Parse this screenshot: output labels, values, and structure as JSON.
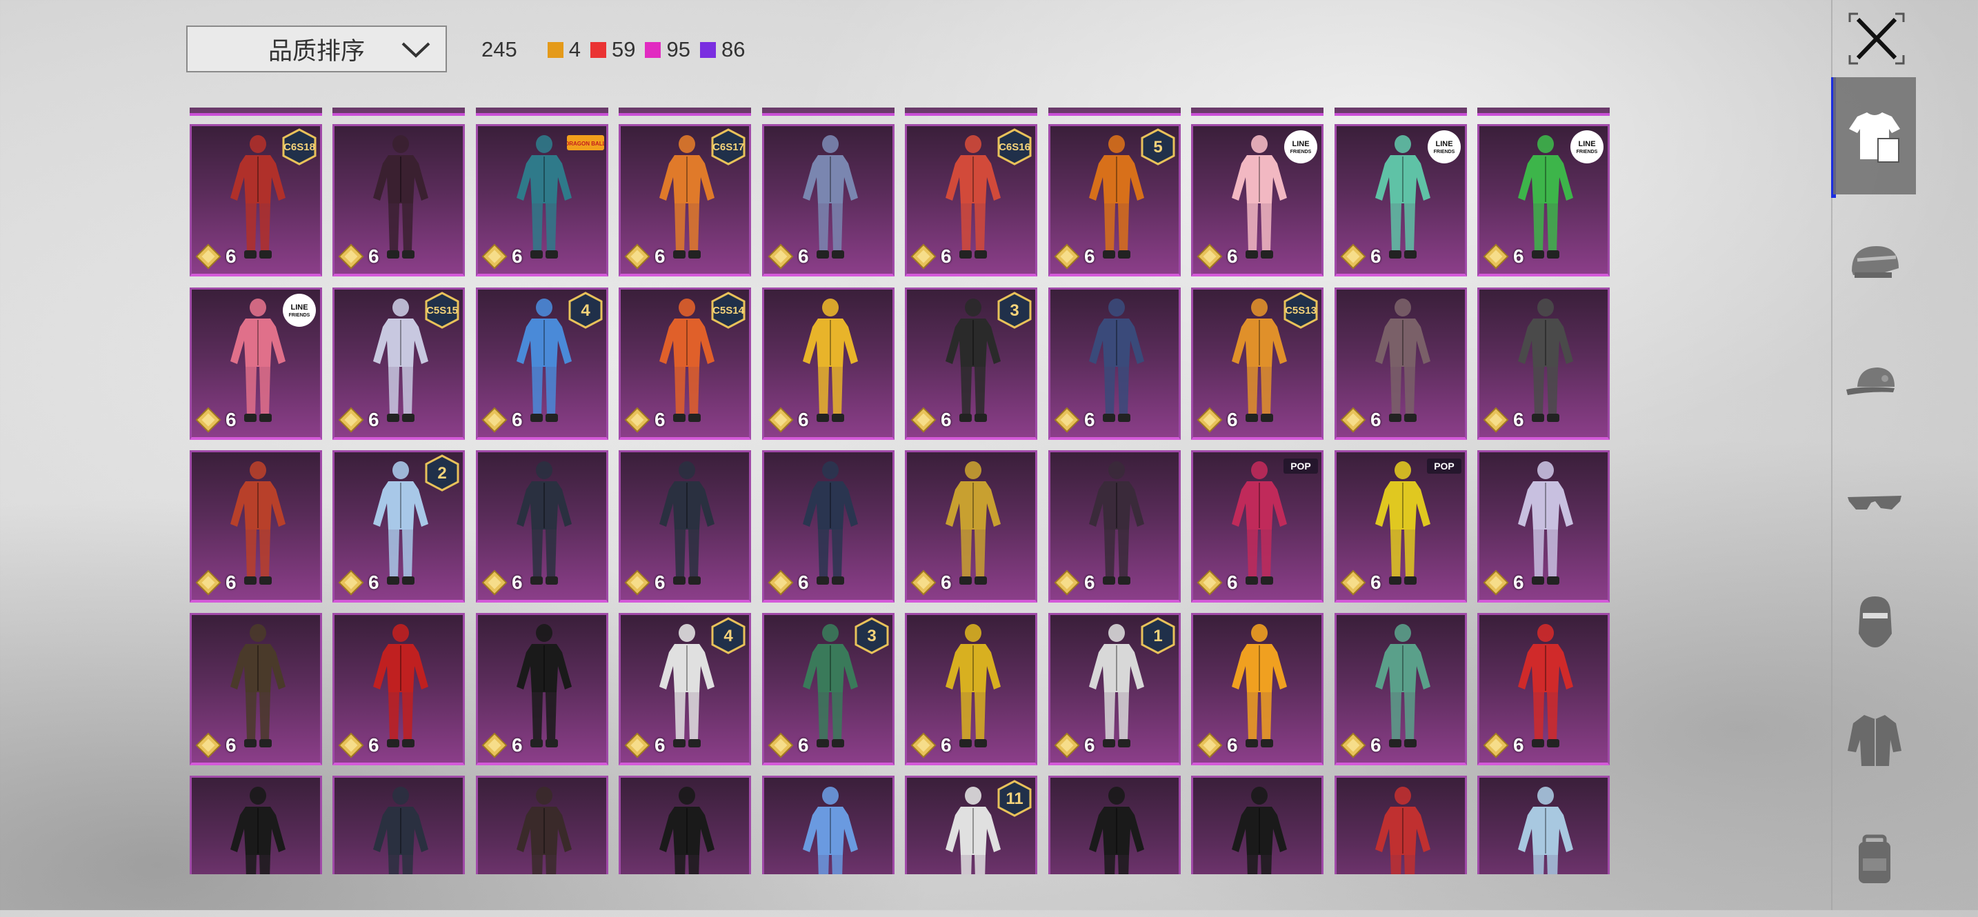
{
  "toolbar": {
    "sort_label": "品质排序",
    "total": "245",
    "rarity_counts": [
      {
        "color": "#e49a1a",
        "count": "4"
      },
      {
        "color": "#ea3333",
        "count": "59"
      },
      {
        "color": "#e12bc1",
        "count": "95"
      },
      {
        "color": "#7a2ee0",
        "count": "86"
      }
    ]
  },
  "sidebar": {
    "tabs": [
      {
        "name": "outfit-tab",
        "icon": "shirt-icon",
        "active": true
      },
      {
        "name": "helmet-tab",
        "icon": "helmet-icon",
        "active": false
      },
      {
        "name": "cap-tab",
        "icon": "cap-icon",
        "active": false
      },
      {
        "name": "glasses-tab",
        "icon": "glasses-icon",
        "active": false
      },
      {
        "name": "mask-tab",
        "icon": "mask-icon",
        "active": false
      },
      {
        "name": "jacket-tab",
        "icon": "jacket-icon",
        "active": false
      },
      {
        "name": "backpack-tab",
        "icon": "backpack-icon",
        "active": false
      }
    ]
  },
  "items": [
    {
      "row": 0,
      "col": 0,
      "badge": "C6S18",
      "price": "6",
      "color": "#b0302a"
    },
    {
      "row": 0,
      "col": 1,
      "badge": "",
      "price": "6",
      "color": "#3a2030"
    },
    {
      "row": 0,
      "col": 2,
      "badge": "DRAGON BALL",
      "price": "6",
      "color": "#2f7a8a"
    },
    {
      "row": 0,
      "col": 3,
      "badge": "C6S17",
      "price": "6",
      "color": "#e07a2a"
    },
    {
      "row": 0,
      "col": 4,
      "badge": "",
      "price": "6",
      "color": "#7a86b0"
    },
    {
      "row": 0,
      "col": 5,
      "badge": "C6S16",
      "price": "6",
      "color": "#d24a3a"
    },
    {
      "row": 0,
      "col": 6,
      "badge": "5",
      "price": "6",
      "color": "#d8701a"
    },
    {
      "row": 0,
      "col": 7,
      "badge": "LINE FRIENDS",
      "price": "6",
      "color": "#f2b8c2"
    },
    {
      "row": 0,
      "col": 8,
      "badge": "LINE FRIENDS",
      "price": "6",
      "color": "#5fc2a6"
    },
    {
      "row": 0,
      "col": 9,
      "badge": "LINE FRIENDS",
      "price": "6",
      "color": "#3db54a"
    },
    {
      "row": 1,
      "col": 0,
      "badge": "LINE FRIENDS",
      "price": "6",
      "color": "#e0708a"
    },
    {
      "row": 1,
      "col": 1,
      "badge": "C5S15",
      "price": "6",
      "color": "#c8c8e0"
    },
    {
      "row": 1,
      "col": 2,
      "badge": "4",
      "price": "6",
      "color": "#4a8ad8"
    },
    {
      "row": 1,
      "col": 3,
      "badge": "C5S14",
      "price": "6",
      "color": "#e0602a"
    },
    {
      "row": 1,
      "col": 4,
      "badge": "",
      "price": "6",
      "color": "#e8b42a"
    },
    {
      "row": 1,
      "col": 5,
      "badge": "3",
      "price": "6",
      "color": "#2a2a2a"
    },
    {
      "row": 1,
      "col": 6,
      "badge": "",
      "price": "6",
      "color": "#3a4a7a"
    },
    {
      "row": 1,
      "col": 7,
      "badge": "C5S13",
      "price": "6",
      "color": "#e0902a"
    },
    {
      "row": 1,
      "col": 8,
      "badge": "",
      "price": "6",
      "color": "#7a6068"
    },
    {
      "row": 1,
      "col": 9,
      "badge": "",
      "price": "6",
      "color": "#4a4a4a"
    },
    {
      "row": 2,
      "col": 0,
      "badge": "",
      "price": "6",
      "color": "#b8402a"
    },
    {
      "row": 2,
      "col": 1,
      "badge": "2",
      "price": "6",
      "color": "#a8c8e8"
    },
    {
      "row": 2,
      "col": 2,
      "badge": "",
      "price": "6",
      "color": "#2a3040"
    },
    {
      "row": 2,
      "col": 3,
      "badge": "",
      "price": "6",
      "color": "#2a3040"
    },
    {
      "row": 2,
      "col": 4,
      "badge": "",
      "price": "6",
      "color": "#2a3550"
    },
    {
      "row": 2,
      "col": 5,
      "badge": "",
      "price": "6",
      "color": "#c8a030"
    },
    {
      "row": 2,
      "col": 6,
      "badge": "",
      "price": "6",
      "color": "#3a2a3a"
    },
    {
      "row": 2,
      "col": 7,
      "badge": "POP",
      "price": "6",
      "color": "#c02a5a"
    },
    {
      "row": 2,
      "col": 8,
      "badge": "POP",
      "price": "6",
      "color": "#e0c820"
    },
    {
      "row": 2,
      "col": 9,
      "badge": "",
      "price": "6",
      "color": "#c8c0e0"
    },
    {
      "row": 3,
      "col": 0,
      "badge": "",
      "price": "6",
      "color": "#4a3a2a"
    },
    {
      "row": 3,
      "col": 1,
      "badge": "",
      "price": "6",
      "color": "#c02020"
    },
    {
      "row": 3,
      "col": 2,
      "badge": "",
      "price": "6",
      "color": "#1a1a1a"
    },
    {
      "row": 3,
      "col": 3,
      "badge": "4",
      "price": "6",
      "color": "#e0e0e0"
    },
    {
      "row": 3,
      "col": 4,
      "badge": "3",
      "price": "6",
      "color": "#3a7a5a"
    },
    {
      "row": 3,
      "col": 5,
      "badge": "",
      "price": "6",
      "color": "#d8b020"
    },
    {
      "row": 3,
      "col": 6,
      "badge": "1",
      "price": "6",
      "color": "#d8d8d8"
    },
    {
      "row": 3,
      "col": 7,
      "badge": "",
      "price": "6",
      "color": "#f0a020"
    },
    {
      "row": 3,
      "col": 8,
      "badge": "",
      "price": "6",
      "color": "#5aa08a"
    },
    {
      "row": 3,
      "col": 9,
      "badge": "",
      "price": "6",
      "color": "#d02a2a"
    },
    {
      "row": 4,
      "col": 0,
      "badge": "",
      "price": "",
      "color": "#1a1a1a"
    },
    {
      "row": 4,
      "col": 1,
      "badge": "",
      "price": "",
      "color": "#2a3040"
    },
    {
      "row": 4,
      "col": 2,
      "badge": "",
      "price": "",
      "color": "#3a2a2a"
    },
    {
      "row": 4,
      "col": 3,
      "badge": "",
      "price": "",
      "color": "#1a1a1a"
    },
    {
      "row": 4,
      "col": 4,
      "badge": "",
      "price": "",
      "color": "#6a9ae0"
    },
    {
      "row": 4,
      "col": 5,
      "badge": "11",
      "price": "",
      "color": "#e0e0e0"
    },
    {
      "row": 4,
      "col": 6,
      "badge": "",
      "price": "",
      "color": "#1a1a1a"
    },
    {
      "row": 4,
      "col": 7,
      "badge": "",
      "price": "",
      "color": "#1a1a1a"
    },
    {
      "row": 4,
      "col": 8,
      "badge": "",
      "price": "",
      "color": "#c03030"
    },
    {
      "row": 4,
      "col": 9,
      "badge": "",
      "price": "",
      "color": "#a8c8e0"
    }
  ]
}
